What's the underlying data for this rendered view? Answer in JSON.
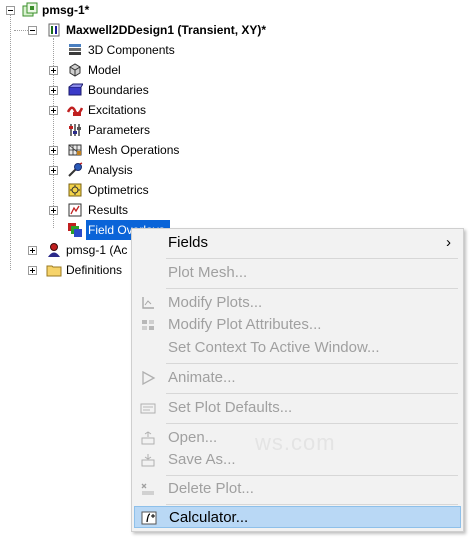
{
  "tree": {
    "root": "pmsg-1*",
    "design": "Maxwell2DDesign1 (Transient, XY)*",
    "items": [
      {
        "label": "3D Components"
      },
      {
        "label": "Model"
      },
      {
        "label": "Boundaries"
      },
      {
        "label": "Excitations"
      },
      {
        "label": "Parameters"
      },
      {
        "label": "Mesh Operations"
      },
      {
        "label": "Analysis"
      },
      {
        "label": "Optimetrics"
      },
      {
        "label": "Results"
      },
      {
        "label": "Field Overlays"
      }
    ],
    "siblings": [
      {
        "label": "pmsg-1 (Ac"
      },
      {
        "label": "Definitions"
      }
    ]
  },
  "context_menu": {
    "items": [
      {
        "label": "Fields",
        "enabled": true,
        "submenu": "›"
      },
      {
        "label": "Plot Mesh...",
        "enabled": false
      },
      {
        "label": "Modify Plots...",
        "enabled": false
      },
      {
        "label": "Modify Plot Attributes...",
        "enabled": false
      },
      {
        "label": "Set Context To Active Window...",
        "enabled": false
      },
      {
        "label": "Animate...",
        "enabled": false
      },
      {
        "label": "Set Plot Defaults...",
        "enabled": false
      },
      {
        "label": "Open...",
        "enabled": false
      },
      {
        "label": "Save As...",
        "enabled": false
      },
      {
        "label": "Delete Plot...",
        "enabled": false
      },
      {
        "label": "Calculator...",
        "enabled": true,
        "highlighted": true
      }
    ]
  },
  "watermark": "ws.com",
  "colors": {
    "selection": "#0a64d8",
    "menu_bg": "#f2f2f2",
    "menu_highlight": "#b9d8f5",
    "disabled_text": "#a0a0a0"
  }
}
